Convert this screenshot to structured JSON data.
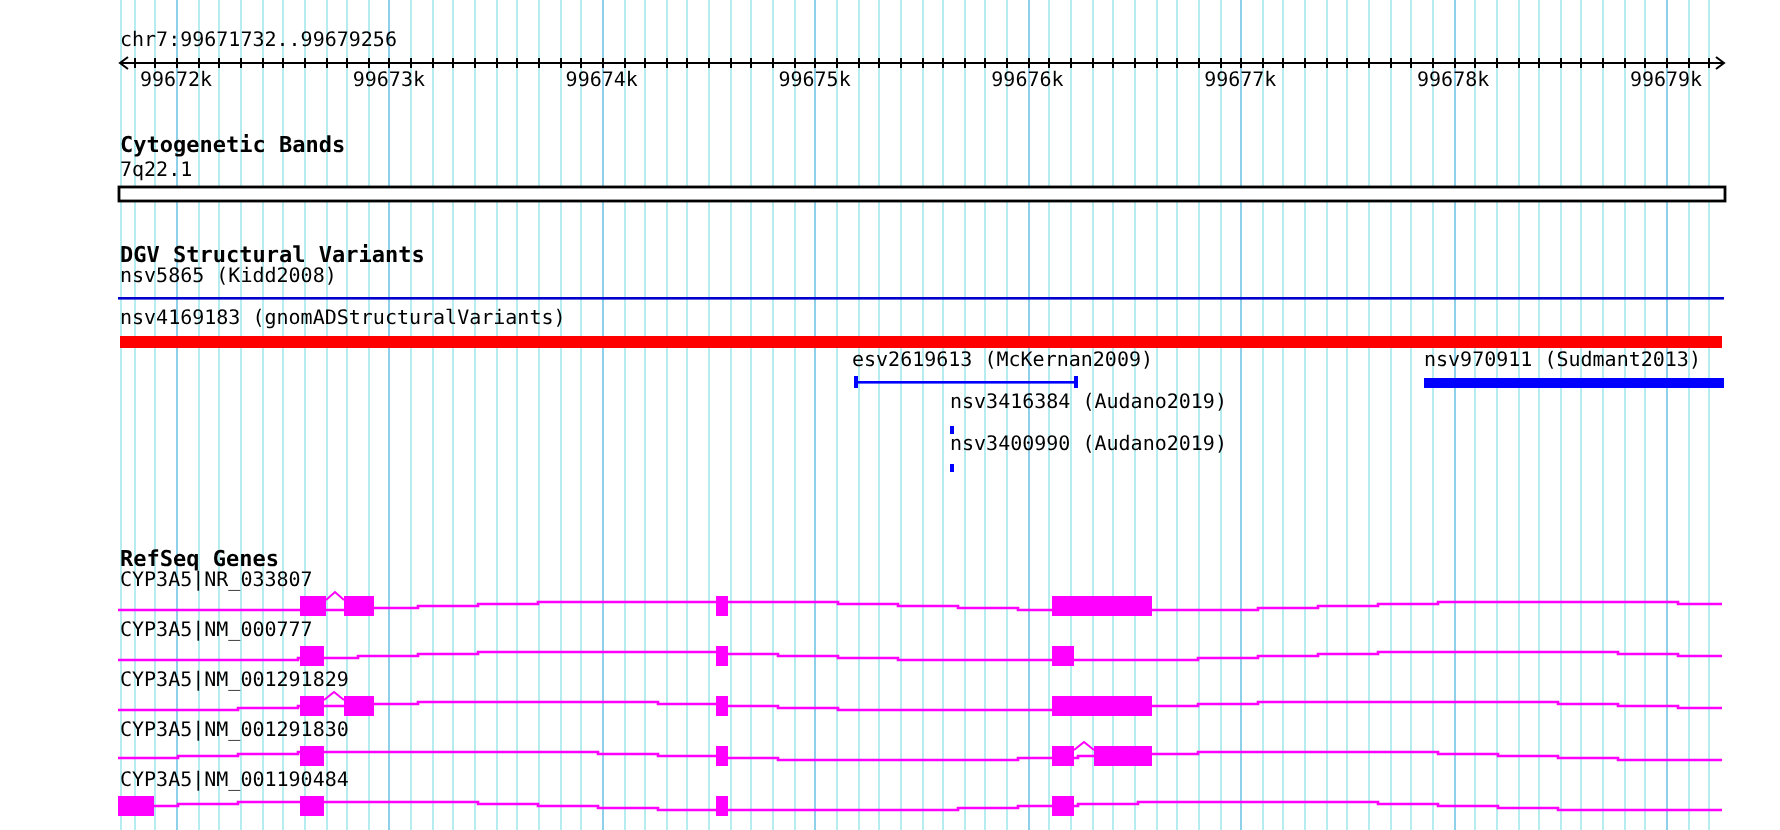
{
  "location": "chr7:99671732..99679256",
  "ruler": {
    "labels": [
      "99672k",
      "99673k",
      "99674k",
      "99675k",
      "99676k",
      "99677k",
      "99678k",
      "99679k"
    ]
  },
  "tracks": [
    {
      "title": "Cytogenetic Bands",
      "kind": "bands",
      "features": [
        {
          "label": "7q22.1"
        }
      ]
    },
    {
      "title": "DGV Structural Variants",
      "kind": "variants",
      "features": [
        {
          "label": "nsv5865 (Kidd2008)",
          "color": "#0000cc"
        },
        {
          "label": "nsv4169183 (gnomADStructuralVariants)",
          "color": "#ff0000"
        },
        {
          "label": "esv2619613 (McKernan2009)",
          "color": "#0000ff"
        },
        {
          "label": "nsv970911 (Sudmant2013)",
          "color": "#0000ff"
        },
        {
          "label": "nsv3416384 (Audano2019)",
          "color": "#0000ff"
        },
        {
          "label": "nsv3400990 (Audano2019)",
          "color": "#0000ff"
        }
      ]
    },
    {
      "title": "RefSeq Genes",
      "kind": "genes",
      "features": [
        {
          "label": "CYP3A5|NR_033807"
        },
        {
          "label": "CYP3A5|NM_000777"
        },
        {
          "label": "CYP3A5|NM_001291829"
        },
        {
          "label": "CYP3A5|NM_001291830"
        },
        {
          "label": "CYP3A5|NM_001190484"
        }
      ]
    }
  ]
}
